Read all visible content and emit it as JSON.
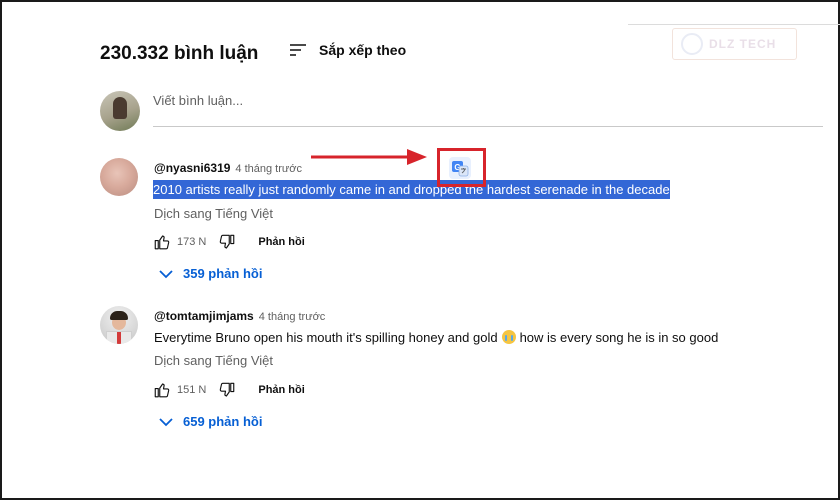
{
  "header": {
    "comment_count": "230.332 bình luận",
    "sort_label": "Sắp xếp theo"
  },
  "watermark": {
    "text": "DLZ TECH"
  },
  "composer": {
    "placeholder": "Viết bình luận..."
  },
  "comments": [
    {
      "username": "@nyasni6319",
      "time": "4 tháng trước",
      "text": "2010 artists really just randomly came in and dropped the hardest serenade in the decade",
      "translate_label": "Dịch sang Tiếng Việt",
      "likes": "173 N",
      "reply_label": "Phản hồi",
      "replies_label": "359 phản hồi",
      "selected": true
    },
    {
      "username": "@tomtamjimjams",
      "time": "4 tháng trước",
      "text_before": "Everytime Bruno open his mouth it's spilling honey and gold",
      "emoji": "crying-face-emoji",
      "text_after": "how is every song he is in so good",
      "translate_label": "Dịch sang Tiếng Việt",
      "likes": "151 N",
      "reply_label": "Phản hồi",
      "replies_label": "659 phản hồi"
    }
  ],
  "icons": [
    "sort-icon",
    "like-icon",
    "dislike-icon",
    "chevron-down-icon",
    "translate-icon"
  ],
  "colors": {
    "link_blue": "#065fd4",
    "selection_blue": "#3367d6",
    "annotation_red": "#d7242b",
    "text_primary": "#0f0f0f",
    "text_secondary": "#606060"
  }
}
